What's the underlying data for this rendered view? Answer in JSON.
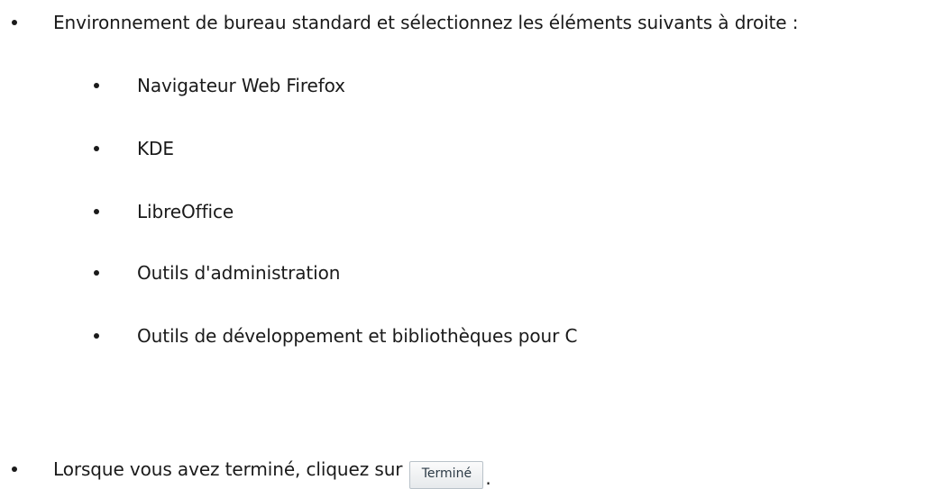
{
  "intro": {
    "text": "Environnement de bureau standard et sélectionnez les éléments suivants à droite :"
  },
  "items": [
    {
      "label": "Navigateur Web Firefox"
    },
    {
      "label": "KDE"
    },
    {
      "label": "LibreOffice"
    },
    {
      "label": "Outils d'administration"
    },
    {
      "label": "Outils de développement et bibliothèques pour C"
    }
  ],
  "final_step": {
    "text": "Lorsque vous avez terminé, cliquez sur",
    "button_label": "Terminé",
    "trailing": "."
  }
}
